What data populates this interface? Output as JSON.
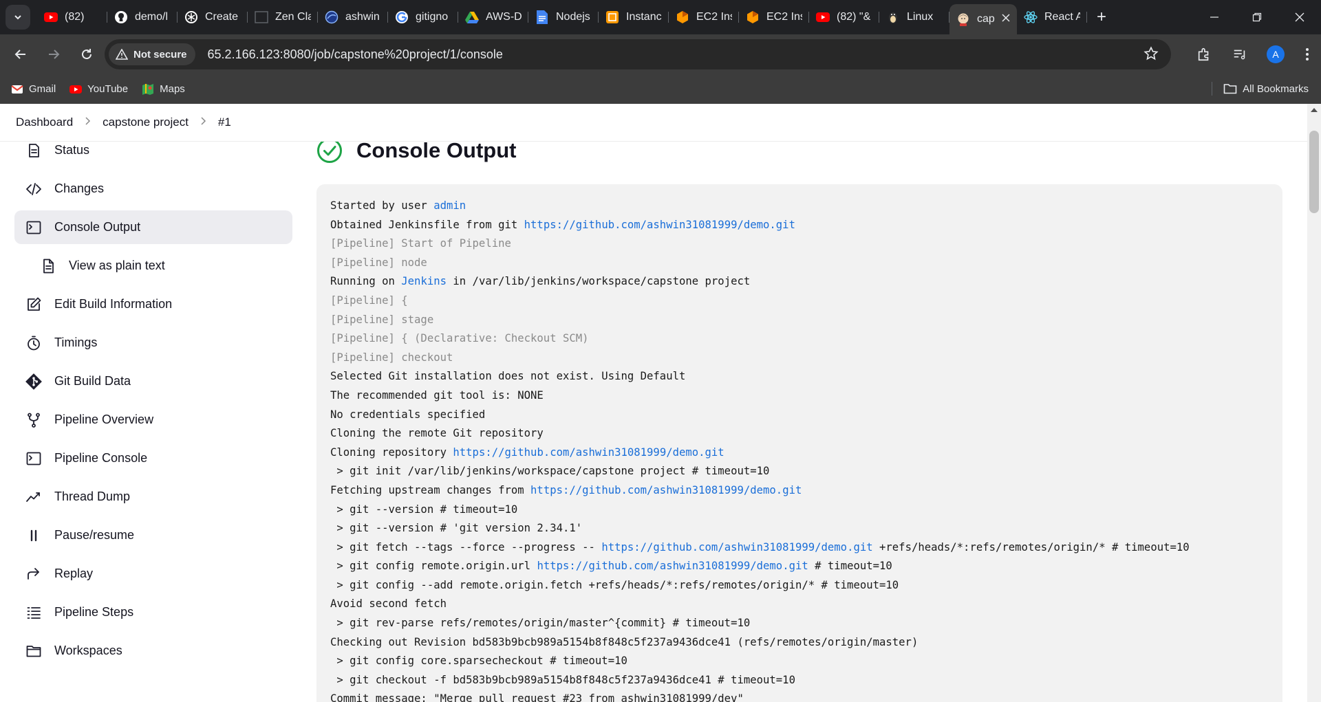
{
  "browser": {
    "tabs": [
      {
        "label": "(82)",
        "icon": "youtube-icon",
        "color": "#ff0000"
      },
      {
        "label": "demo/l",
        "icon": "github-icon",
        "color": "#ffffff"
      },
      {
        "label": "Create",
        "icon": "openai-icon",
        "color": "#ffffff"
      },
      {
        "label": "Zen Cla",
        "icon": "terminal-icon",
        "color": "#5f6368"
      },
      {
        "label": "ashwin",
        "icon": "globe-icon",
        "color": "#8ab4f8"
      },
      {
        "label": "gitigno",
        "icon": "google-icon",
        "color": "#ffffff"
      },
      {
        "label": "AWS-D",
        "icon": "drive-icon",
        "color": "#34a853"
      },
      {
        "label": "Nodejs",
        "icon": "docs-icon",
        "color": "#4285f4"
      },
      {
        "label": "Instanc",
        "icon": "aws-icon",
        "color": "#ff9900"
      },
      {
        "label": "EC2 Ins",
        "icon": "ec2-icon",
        "color": "#ff9900"
      },
      {
        "label": "EC2 Ins",
        "icon": "ec2-icon",
        "color": "#ff9900"
      },
      {
        "label": "(82) \"&",
        "icon": "youtube-icon",
        "color": "#ff0000"
      },
      {
        "label": "Linux",
        "icon": "linux-icon",
        "color": "#f0d7a7"
      },
      {
        "label": "cap",
        "icon": "jenkins-icon",
        "color": "#d33833",
        "active": true
      },
      {
        "label": "React A",
        "icon": "react-icon",
        "color": "#61dafb"
      }
    ],
    "security_label": "Not secure",
    "url": "65.2.166.123:8080/job/capstone%20project/1/console",
    "profile_initial": "A",
    "bookmarks": [
      {
        "label": "Gmail",
        "icon": "gmail-icon"
      },
      {
        "label": "YouTube",
        "icon": "youtube-icon"
      },
      {
        "label": "Maps",
        "icon": "maps-icon"
      }
    ],
    "all_bookmarks_label": "All Bookmarks"
  },
  "breadcrumb": {
    "dashboard": "Dashboard",
    "project": "capstone project",
    "build": "#1"
  },
  "sidebar": {
    "items": [
      {
        "label": "Status",
        "icon": "status-icon"
      },
      {
        "label": "Changes",
        "icon": "code-icon"
      },
      {
        "label": "Console Output",
        "icon": "terminal-icon",
        "active": true
      },
      {
        "label": "View as plain text",
        "icon": "document-icon",
        "sub": true
      },
      {
        "label": "Edit Build Information",
        "icon": "edit-icon"
      },
      {
        "label": "Timings",
        "icon": "stopwatch-icon"
      },
      {
        "label": "Git Build Data",
        "icon": "git-icon"
      },
      {
        "label": "Pipeline Overview",
        "icon": "branch-icon"
      },
      {
        "label": "Pipeline Console",
        "icon": "terminal-icon"
      },
      {
        "label": "Thread Dump",
        "icon": "pulse-icon"
      },
      {
        "label": "Pause/resume",
        "icon": "pause-icon"
      },
      {
        "label": "Replay",
        "icon": "replay-icon"
      },
      {
        "label": "Pipeline Steps",
        "icon": "list-icon"
      },
      {
        "label": "Workspaces",
        "icon": "folder-icon"
      }
    ]
  },
  "main": {
    "title": "Console Output",
    "status_color": "#1ea446",
    "console_lines": [
      {
        "type": "text",
        "parts": [
          {
            "t": "Started by user "
          },
          {
            "t": "admin",
            "link": true
          }
        ]
      },
      {
        "type": "text",
        "parts": [
          {
            "t": "Obtained Jenkinsfile from git "
          },
          {
            "t": "https://github.com/ashwin31081999/demo.git",
            "link": true
          }
        ]
      },
      {
        "type": "pipe",
        "parts": [
          {
            "t": "[Pipeline] Start of Pipeline"
          }
        ]
      },
      {
        "type": "pipe",
        "parts": [
          {
            "t": "[Pipeline] node"
          }
        ]
      },
      {
        "type": "text",
        "parts": [
          {
            "t": "Running on "
          },
          {
            "t": "Jenkins",
            "link": true
          },
          {
            "t": " in /var/lib/jenkins/workspace/capstone project"
          }
        ]
      },
      {
        "type": "pipe",
        "parts": [
          {
            "t": "[Pipeline] {"
          }
        ]
      },
      {
        "type": "pipe",
        "parts": [
          {
            "t": "[Pipeline] stage"
          }
        ]
      },
      {
        "type": "pipe",
        "parts": [
          {
            "t": "[Pipeline] { (Declarative: Checkout SCM)"
          }
        ]
      },
      {
        "type": "pipe",
        "parts": [
          {
            "t": "[Pipeline] checkout"
          }
        ]
      },
      {
        "type": "text",
        "parts": [
          {
            "t": "Selected Git installation does not exist. Using Default"
          }
        ]
      },
      {
        "type": "text",
        "parts": [
          {
            "t": "The recommended git tool is: NONE"
          }
        ]
      },
      {
        "type": "text",
        "parts": [
          {
            "t": "No credentials specified"
          }
        ]
      },
      {
        "type": "text",
        "parts": [
          {
            "t": "Cloning the remote Git repository"
          }
        ]
      },
      {
        "type": "text",
        "parts": [
          {
            "t": "Cloning repository "
          },
          {
            "t": "https://github.com/ashwin31081999/demo.git",
            "link": true
          }
        ]
      },
      {
        "type": "text",
        "parts": [
          {
            "t": " > git init /var/lib/jenkins/workspace/capstone project # timeout=10"
          }
        ]
      },
      {
        "type": "text",
        "parts": [
          {
            "t": "Fetching upstream changes from "
          },
          {
            "t": "https://github.com/ashwin31081999/demo.git",
            "link": true
          }
        ]
      },
      {
        "type": "text",
        "parts": [
          {
            "t": " > git --version # timeout=10"
          }
        ]
      },
      {
        "type": "text",
        "parts": [
          {
            "t": " > git --version # 'git version 2.34.1'"
          }
        ]
      },
      {
        "type": "text",
        "parts": [
          {
            "t": " > git fetch --tags --force --progress -- "
          },
          {
            "t": "https://github.com/ashwin31081999/demo.git",
            "link": true
          },
          {
            "t": " +refs/heads/*:refs/remotes/origin/* # timeout=10"
          }
        ]
      },
      {
        "type": "text",
        "parts": [
          {
            "t": " > git config remote.origin.url "
          },
          {
            "t": "https://github.com/ashwin31081999/demo.git",
            "link": true
          },
          {
            "t": " # timeout=10"
          }
        ]
      },
      {
        "type": "text",
        "parts": [
          {
            "t": " > git config --add remote.origin.fetch +refs/heads/*:refs/remotes/origin/* # timeout=10"
          }
        ]
      },
      {
        "type": "text",
        "parts": [
          {
            "t": "Avoid second fetch"
          }
        ]
      },
      {
        "type": "text",
        "parts": [
          {
            "t": " > git rev-parse refs/remotes/origin/master^{commit} # timeout=10"
          }
        ]
      },
      {
        "type": "text",
        "parts": [
          {
            "t": "Checking out Revision bd583b9bcb989a5154b8f848c5f237a9436dce41 (refs/remotes/origin/master)"
          }
        ]
      },
      {
        "type": "text",
        "parts": [
          {
            "t": " > git config core.sparsecheckout # timeout=10"
          }
        ]
      },
      {
        "type": "text",
        "parts": [
          {
            "t": " > git checkout -f bd583b9bcb989a5154b8f848c5f237a9436dce41 # timeout=10"
          }
        ]
      },
      {
        "type": "text",
        "parts": [
          {
            "t": "Commit message: \"Merge pull request #23 from ashwin31081999/dev\""
          }
        ]
      }
    ]
  }
}
